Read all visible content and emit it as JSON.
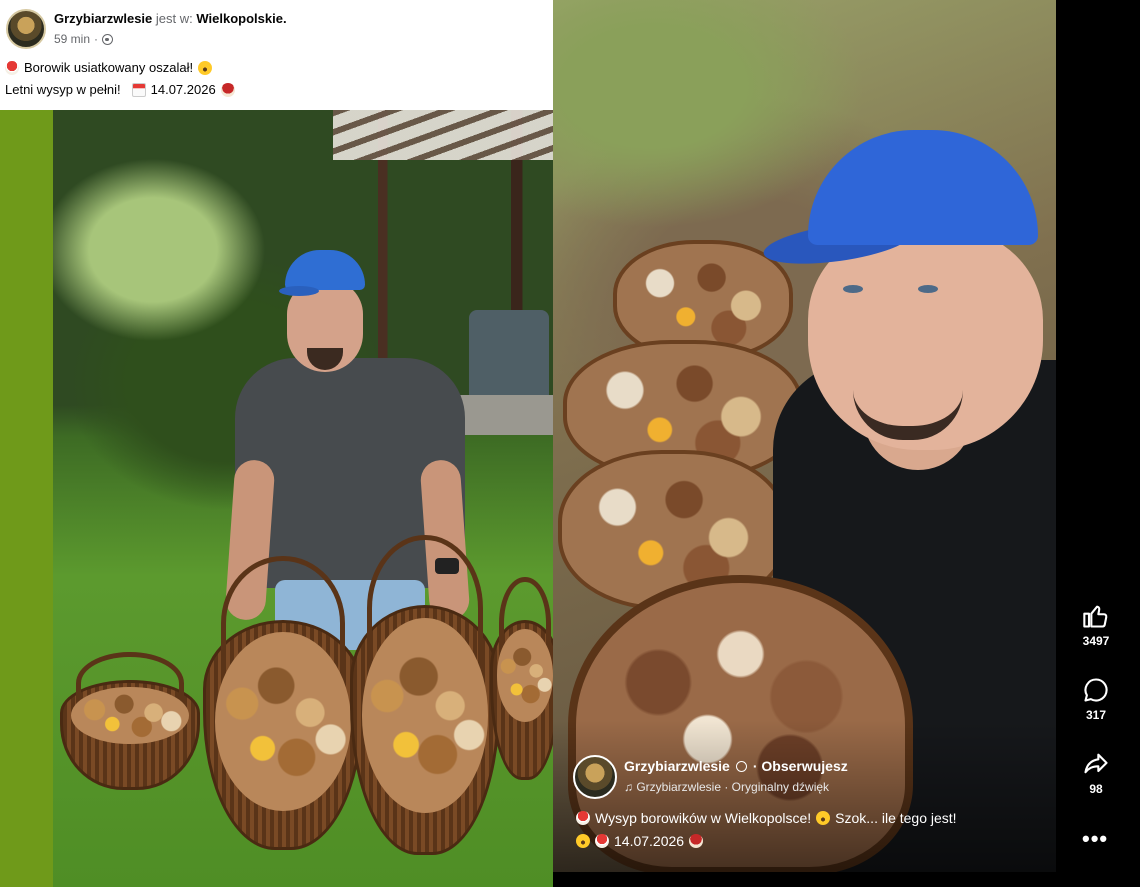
{
  "post": {
    "author": "Grzybiarzwlesie",
    "is_in": "jest w:",
    "location": "Wielkopolskie.",
    "time": "59 min",
    "line1": "Borowik usiatkowany oszalał!",
    "line2": "Letni wysyp w pełni!",
    "date": "14.07.2026"
  },
  "reel": {
    "author": "Grzybiarzwlesie",
    "follow": "· Obserwujesz",
    "sound": "♫ Grzybiarzwlesie · Oryginalny dźwięk",
    "caption1": "Wysyp borowików w Wielkopolsce!",
    "caption1b": "Szok... ile tego jest!",
    "caption2_date": "14.07.2026"
  },
  "actions": {
    "likes": "3497",
    "comments": "317",
    "shares": "98"
  },
  "colors": {
    "accent_blue": "#2f66d8",
    "sidebar": "#000000",
    "text": "#050505"
  },
  "icons": [
    "globe-icon",
    "mushroom-emoji-icon",
    "shocked-emoji-icon",
    "calendar-emoji-icon",
    "like-icon",
    "comment-icon",
    "share-icon",
    "more-icon",
    "verified-icon"
  ]
}
